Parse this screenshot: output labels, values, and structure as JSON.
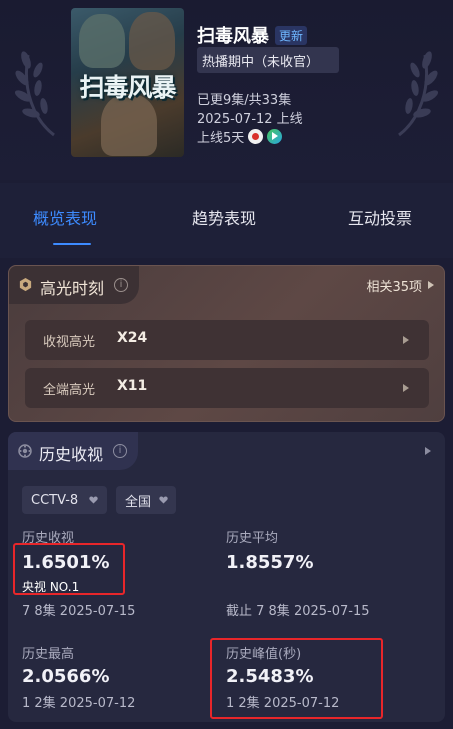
{
  "show": {
    "title": "扫毒风暴",
    "poster_text": "扫毒风暴",
    "badge": "更新",
    "status": "热播期中（未收官）",
    "episodes": "已更9集/共33集",
    "date": "2025-07-12 上线",
    "days_online": "上线5天",
    "platforms": [
      "cctv-icon",
      "play-icon"
    ]
  },
  "tabs": [
    {
      "label": "概览表现",
      "active": true
    },
    {
      "label": "趋势表现",
      "active": false
    },
    {
      "label": "互动投票",
      "active": false
    }
  ],
  "highlights": {
    "title": "高光时刻",
    "info": "i",
    "related": "相关35项",
    "rows": [
      {
        "label": "收视高光",
        "value": "X24"
      },
      {
        "label": "全端高光",
        "value": "X11"
      }
    ]
  },
  "history": {
    "title": "历史收视",
    "info": "i",
    "filters": {
      "channel": "CCTV-8",
      "region": "全国"
    },
    "stats": [
      {
        "label": "历史收视",
        "value": "1.6501%",
        "note": "央视 NO.1",
        "sub": "7 8集 2025-07-15"
      },
      {
        "label": "历史平均",
        "value": "1.8557%",
        "sub": "截止 7 8集 2025-07-15"
      },
      {
        "label": "历史最高",
        "value": "2.0566%",
        "sub": "1 2集 2025-07-12"
      },
      {
        "label": "历史峰值(秒)",
        "value": "2.5483%",
        "sub": "1 2集 2025-07-12"
      }
    ]
  },
  "colors": {
    "background": "#1c1d34",
    "accent": "#3d8bff",
    "highlight_bg": "#5e4845",
    "annotation_red": "#e8262a"
  }
}
